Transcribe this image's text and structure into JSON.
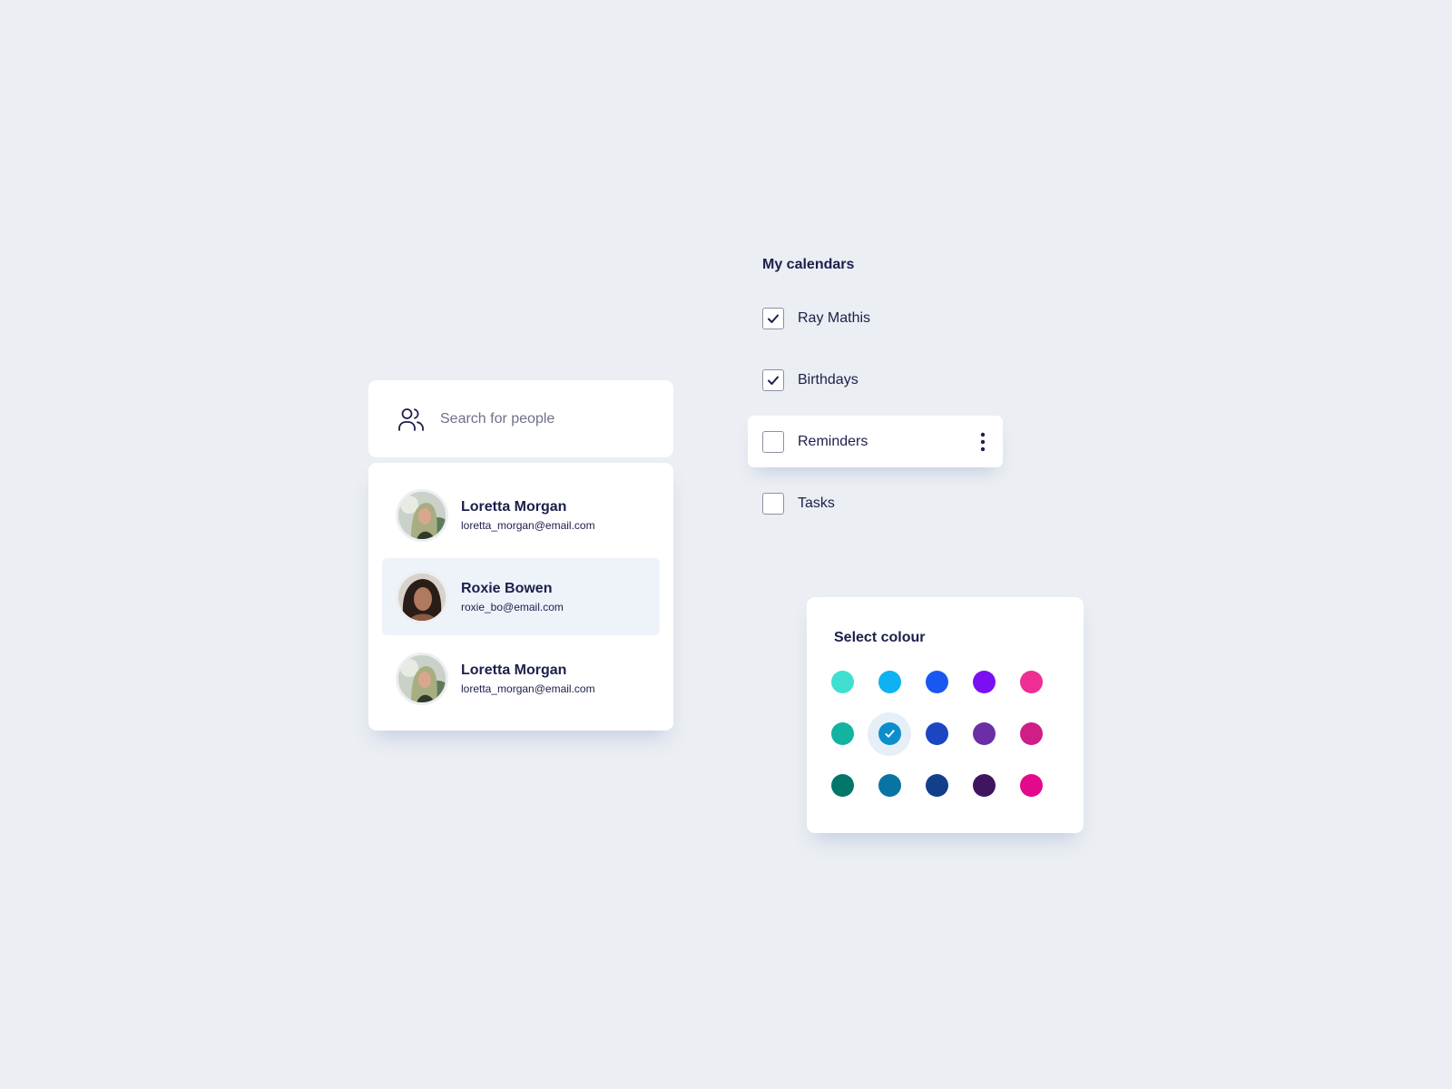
{
  "search": {
    "placeholder": "Search for people",
    "icon": "people-icon"
  },
  "people": [
    {
      "name": "Loretta Morgan",
      "email": "loretta_morgan@email.com",
      "selected": false
    },
    {
      "name": "Roxie Bowen",
      "email": "roxie_bo@email.com",
      "selected": true
    },
    {
      "name": "Loretta Morgan",
      "email": "loretta_morgan@email.com",
      "selected": false
    }
  ],
  "calendars": {
    "title": "My calendars",
    "items": [
      {
        "label": "Ray Mathis",
        "checked": true,
        "highlighted": false
      },
      {
        "label": "Birthdays",
        "checked": true,
        "highlighted": false
      },
      {
        "label": "Reminders",
        "checked": false,
        "highlighted": true
      },
      {
        "label": "Tasks",
        "checked": false,
        "highlighted": false
      }
    ]
  },
  "colour_picker": {
    "title": "Select colour",
    "selected_index": 6,
    "swatches": [
      "#40e0d0",
      "#0eb1f2",
      "#1958f0",
      "#7a0ff2",
      "#ee2e92",
      "#13b3a2",
      "#0b8ecc",
      "#1a46c2",
      "#6b2ea6",
      "#cf1e86",
      "#03766a",
      "#0874a3",
      "#123f8a",
      "#3f1560",
      "#e4088c"
    ]
  },
  "colors": {
    "text": "#1b1f4b",
    "background": "#ebeef2",
    "selected_row": "#eef2f9"
  }
}
